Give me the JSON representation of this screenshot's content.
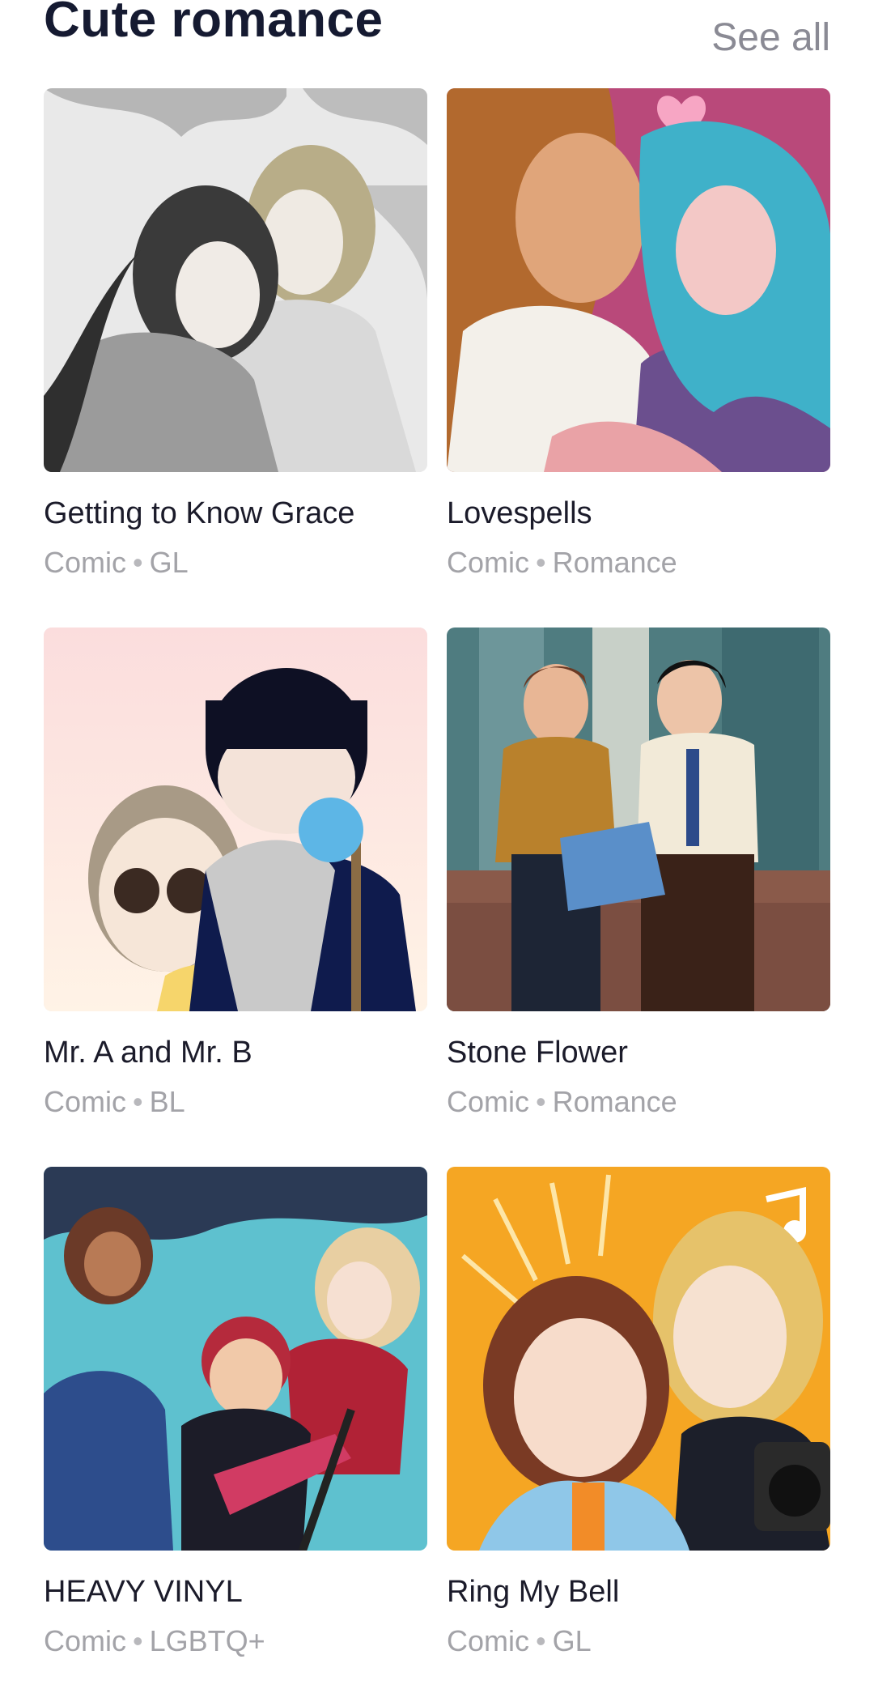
{
  "section": {
    "title": "Cute romance",
    "see_all_label": "See all"
  },
  "items": [
    {
      "title": "Getting to Know Grace",
      "type": "Comic",
      "genre": "GL"
    },
    {
      "title": "Lovespells",
      "type": "Comic",
      "genre": "Romance"
    },
    {
      "title": "Mr. A and Mr. B",
      "type": "Comic",
      "genre": "BL"
    },
    {
      "title": "Stone Flower",
      "type": "Comic",
      "genre": "Romance"
    },
    {
      "title": "HEAVY VINYL",
      "type": "Comic",
      "genre": "LGBTQ+"
    },
    {
      "title": "Ring My Bell",
      "type": "Comic",
      "genre": "GL"
    }
  ],
  "separator": "•"
}
